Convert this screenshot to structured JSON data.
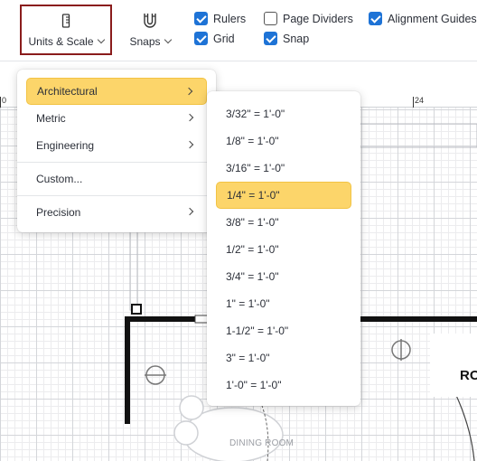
{
  "toolbar": {
    "units_label": "Units & Scale",
    "snaps_label": "Snaps",
    "checkboxes": [
      {
        "label": "Rulers",
        "checked": true
      },
      {
        "label": "Page Dividers",
        "checked": false
      },
      {
        "label": "Alignment Guides",
        "checked": true
      },
      {
        "label": "Grid",
        "checked": true
      },
      {
        "label": "Snap",
        "checked": true
      }
    ]
  },
  "ruler": {
    "labels": [
      "0",
      "24"
    ]
  },
  "units_menu": {
    "items": [
      {
        "label": "Architectural",
        "selected": true,
        "submenu": true
      },
      {
        "label": "Metric",
        "selected": false,
        "submenu": true
      },
      {
        "label": "Engineering",
        "selected": false,
        "submenu": true
      },
      {
        "label": "Custom...",
        "selected": false,
        "submenu": false
      },
      {
        "label": "Precision",
        "selected": false,
        "submenu": true
      }
    ]
  },
  "scale_menu": {
    "items": [
      "3/32\" = 1'-0\"",
      "1/8\" = 1'-0\"",
      "3/16\" = 1'-0\"",
      "1/4\" = 1'-0\"",
      "3/8\" = 1'-0\"",
      "1/2\" = 1'-0\"",
      "3/4\" = 1'-0\"",
      "1\" = 1'-0\"",
      "1-1/2\" = 1'-0\"",
      "3\" = 1'-0\"",
      "1'-0\" = 1'-0\""
    ],
    "selected_index": 3
  },
  "plan": {
    "room_label": "DINING ROOM",
    "room_label_2": "RO"
  },
  "colors": {
    "accent": "#1e73d6",
    "highlight": "#fcd56a",
    "focus_border": "#8a1c1c"
  }
}
